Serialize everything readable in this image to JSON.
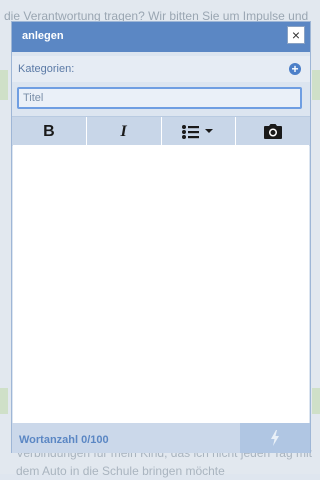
{
  "background": {
    "top_text": "die Verantwortung tragen? Wir bitten Sie um Impulse und",
    "bottom_text": "Verbindungen für mein Kind, das ich nicht jeden Tag mit dem Auto in die Schule bringen möchte"
  },
  "modal": {
    "title": "anlegen",
    "close_label": "×",
    "categories_label": "Kategorien:",
    "title_placeholder": "Titel",
    "toolbar": {
      "bold_label": "B",
      "italic_label": "I"
    },
    "footer": {
      "word_count": "Wortanzahl 0/100"
    }
  },
  "colors": {
    "header": "#5b87c4",
    "accent": "#4c7fc8",
    "footer": "#cbd8ea"
  },
  "icons": [
    "close-icon",
    "add-category-icon",
    "bold-icon",
    "italic-icon",
    "list-icon",
    "camera-icon",
    "bolt-icon"
  ]
}
